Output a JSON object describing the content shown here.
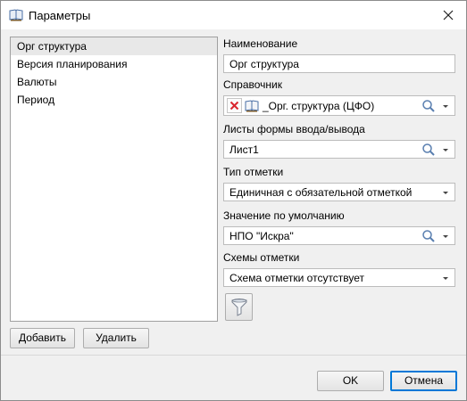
{
  "window": {
    "title": "Параметры"
  },
  "list": {
    "items": [
      {
        "label": "Орг структура",
        "selected": true
      },
      {
        "label": "Версия планирования",
        "selected": false
      },
      {
        "label": "Валюты",
        "selected": false
      },
      {
        "label": "Период",
        "selected": false
      }
    ]
  },
  "buttons": {
    "add": "Добавить",
    "delete": "Удалить",
    "ok": "OK",
    "cancel": "Отмена"
  },
  "form": {
    "name_label": "Наименование",
    "name_value": "Орг структура",
    "dict_label": "Справочник",
    "dict_value": "_Орг. структура (ЦФО)",
    "sheets_label": "Листы формы ввода/вывода",
    "sheets_value": "Лист1",
    "mark_type_label": "Тип отметки",
    "mark_type_value": "Единичная с обязательной отметкой",
    "default_label": "Значение по умолчанию",
    "default_value": "НПО \"Искра\"",
    "schemes_label": "Схемы отметки",
    "schemes_value": "Схема отметки отсутствует"
  },
  "colors": {
    "accent": "#0078d7",
    "delete_icon": "#d9262e"
  }
}
